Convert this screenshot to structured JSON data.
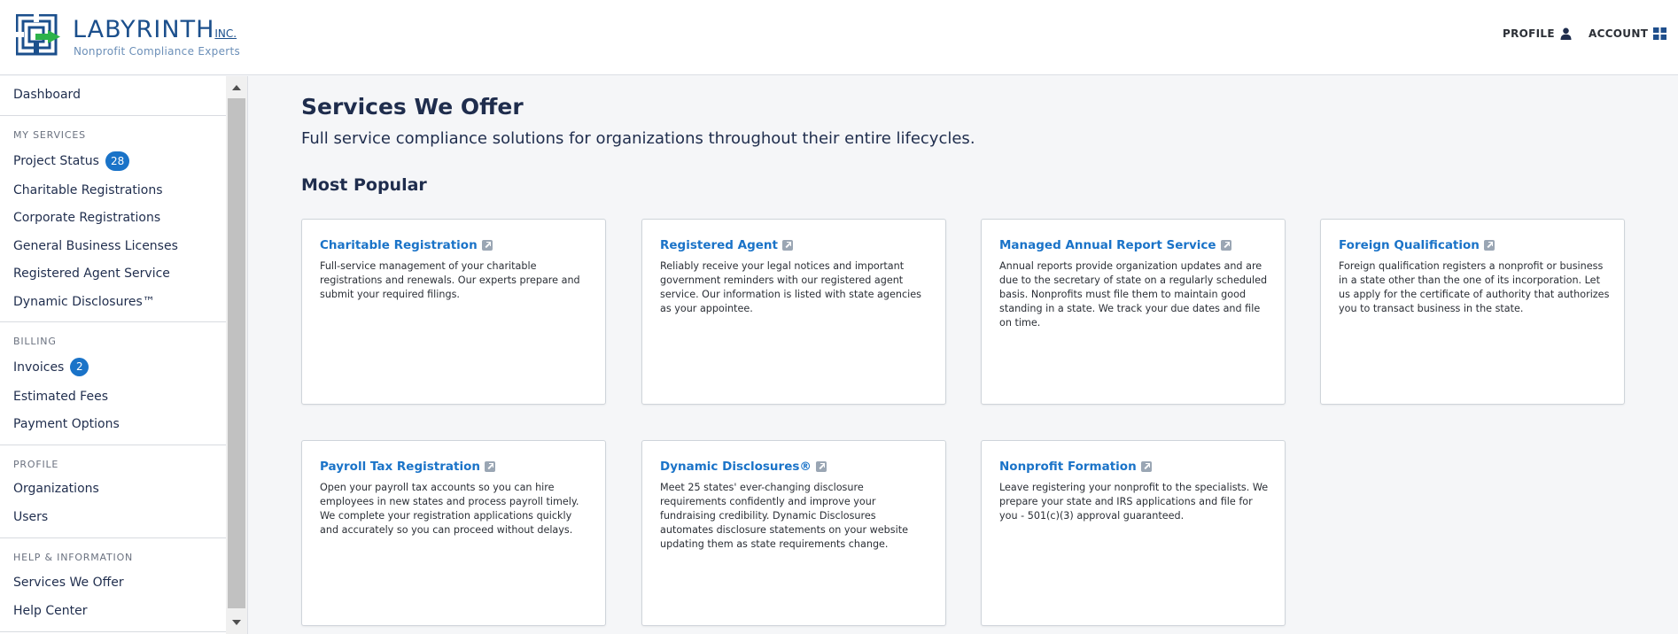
{
  "header": {
    "logo_name": "LABYRINTH",
    "logo_suffix": "INC.",
    "logo_tagline": "Nonprofit Compliance Experts",
    "profile_label": "PROFILE",
    "account_label": "ACCOUNT",
    "brand_color": "#1b4f8c",
    "accent_color": "#2db24a"
  },
  "sidebar": {
    "dashboard": "Dashboard",
    "sections": [
      {
        "heading": "MY SERVICES",
        "items": [
          {
            "label": "Project Status",
            "badge": "28"
          },
          {
            "label": "Charitable Registrations"
          },
          {
            "label": "Corporate Registrations"
          },
          {
            "label": "General Business Licenses"
          },
          {
            "label": "Registered Agent Service"
          },
          {
            "label": "Dynamic Disclosures™"
          }
        ]
      },
      {
        "heading": "BILLING",
        "items": [
          {
            "label": "Invoices",
            "badge": "2"
          },
          {
            "label": "Estimated Fees"
          },
          {
            "label": "Payment Options"
          }
        ]
      },
      {
        "heading": "PROFILE",
        "items": [
          {
            "label": "Organizations"
          },
          {
            "label": "Users"
          }
        ]
      },
      {
        "heading": "HELP & INFORMATION",
        "items": [
          {
            "label": "Services We Offer"
          },
          {
            "label": "Help Center"
          }
        ]
      }
    ]
  },
  "main": {
    "title": "Services We Offer",
    "subtitle": "Full service compliance solutions for organizations throughout their entire lifecycles.",
    "section_title": "Most Popular",
    "cards": [
      {
        "title": "Charitable Registration",
        "desc": "Full-service management of your charitable registrations and renewals. Our experts prepare and submit your required filings."
      },
      {
        "title": "Registered Agent",
        "desc": "Reliably receive your legal notices and important government reminders with our registered agent service. Our information is listed with state agencies as your appointee."
      },
      {
        "title": "Managed Annual Report Service",
        "desc": "Annual reports provide organization updates and are due to the secretary of state on a regularly scheduled basis. Nonprofits must file them to maintain good standing in a state. We track your due dates and file on time."
      },
      {
        "title": "Foreign Qualification",
        "desc": "Foreign qualification registers a nonprofit or business in a state other than the one of its incorporation. Let us apply for the certificate of authority that authorizes you to transact business in the state."
      },
      {
        "title": "Payroll Tax Registration",
        "desc": "Open your payroll tax accounts so you can hire employees in new states and process payroll timely. We complete your registration applications quickly and accurately so you can proceed without delays."
      },
      {
        "title": "Dynamic Disclosures®",
        "desc": "Meet 25 states' ever-changing disclosure requirements confidently and improve your fundraising credibility. Dynamic Disclosures automates disclosure statements on your website updating them as state requirements change."
      },
      {
        "title": "Nonprofit Formation",
        "desc": "Leave registering your nonprofit to the specialists. We prepare your state and IRS applications and file for you - 501(c)(3) approval guaranteed."
      }
    ]
  }
}
